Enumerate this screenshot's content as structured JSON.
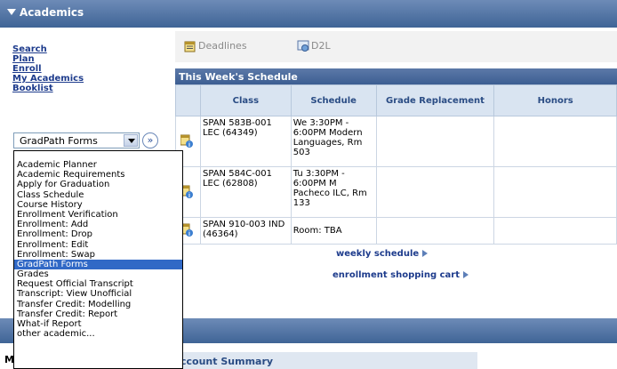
{
  "header": {
    "title": "Academics"
  },
  "nav_links": [
    "Search",
    "Plan",
    "Enroll",
    "My Academics",
    "Booklist"
  ],
  "select": {
    "value": "GradPath Forms"
  },
  "go_button": {
    "label": "»"
  },
  "dropdown": {
    "items": [
      "Academic Planner",
      "Academic Requirements",
      "Apply for Graduation",
      "Class Schedule",
      "Course History",
      "Enrollment Verification",
      "Enrollment: Add",
      "Enrollment: Drop",
      "Enrollment: Edit",
      "Enrollment: Swap",
      "GradPath Forms",
      "Grades",
      "Request Official Transcript",
      "Transcript: View Unofficial",
      "Transfer Credit: Modelling",
      "Transfer Credit: Report",
      "What-if Report",
      "other academic..."
    ],
    "selected": "GradPath Forms"
  },
  "tabs": {
    "deadlines": "Deadlines",
    "d2l": "D2L"
  },
  "schedule": {
    "title": "This Week's Schedule",
    "columns": [
      "Class",
      "Schedule",
      "Grade Replacement",
      "Honors"
    ],
    "rows": [
      {
        "class": "SPAN 583B-001 LEC (64349)",
        "schedule": "We 3:30PM - 6:00PM Modern Languages, Rm 503",
        "grade": "",
        "honors": ""
      },
      {
        "class": "SPAN 584C-001 LEC (62808)",
        "schedule": "Tu 3:30PM - 6:00PM M Pacheco ILC, Rm 133",
        "grade": "",
        "honors": ""
      },
      {
        "class": "SPAN 910-003 IND (46364)",
        "schedule": "Room:  TBA",
        "grade": "",
        "honors": ""
      }
    ]
  },
  "links": {
    "weekly": "weekly schedule",
    "cart": "enrollment shopping cart"
  },
  "account": {
    "title": "ccount Summary"
  },
  "partial_left": "M",
  "colors": {
    "header_bg": "#3f6496",
    "selected_item": "#3169c6",
    "link": "#1d3b8c"
  }
}
